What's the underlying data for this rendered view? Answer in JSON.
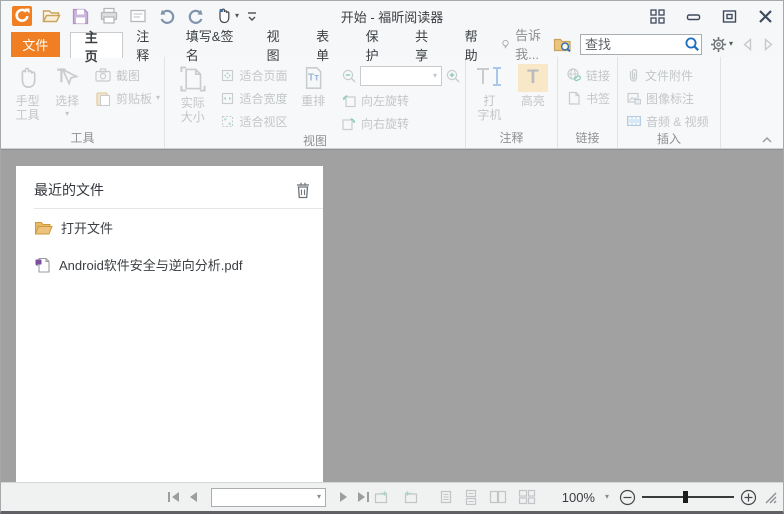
{
  "window": {
    "title": "开始 - 福昕阅读器"
  },
  "tabs": {
    "file": "文件",
    "items": [
      "主页",
      "注释",
      "填写&签名",
      "视图",
      "表单",
      "保护",
      "共享",
      "帮助"
    ],
    "active": "主页",
    "tell_me": "告诉我...",
    "search_placeholder": "查找"
  },
  "ribbon": {
    "tools": {
      "label": "工具",
      "hand": "手型\n工具",
      "select": "选择",
      "snapshot": "截图",
      "clipboard": "剪贴板"
    },
    "view": {
      "label": "视图",
      "actual_size": "实际\n大小",
      "fit_page": "适合页面",
      "fit_width": "适合宽度",
      "fit_visible": "适合视区",
      "reflow": "重排",
      "zoom_value": "",
      "rotate_left": "向左旋转",
      "rotate_right": "向右旋转"
    },
    "comment": {
      "label": "注释",
      "typewriter": "打\n字机",
      "highlight": "高亮"
    },
    "links": {
      "label": "链接",
      "link": "链接",
      "bookmark": "书签"
    },
    "insert": {
      "label": "插入",
      "attachment": "文件附件",
      "image_annotation": "图像标注",
      "audio_video": "音频 & 视频"
    }
  },
  "recent": {
    "title": "最近的文件",
    "open_file": "打开文件",
    "files": [
      "Android软件安全与逆向分析.pdf"
    ]
  },
  "status": {
    "page_value": "",
    "zoom_percent": "100%"
  },
  "icons": {
    "quick_access": [
      "foxit-logo",
      "open-folder-icon",
      "save-icon",
      "print-icon",
      "email-icon",
      "undo-icon",
      "redo-icon",
      "hand-tool-icon",
      "customize-toolbar-icon"
    ],
    "window_controls": [
      "fullscreen-icon",
      "minimize-icon",
      "restore-icon",
      "close-icon"
    ],
    "tab_row": [
      "lightbulb-icon",
      "folder-search-icon",
      "search-icon",
      "gear-icon",
      "back-icon",
      "forward-icon"
    ],
    "panel": [
      "trash-icon",
      "folder-icon",
      "pdf-file-icon"
    ],
    "status_bar": [
      "first-page-icon",
      "prev-page-icon",
      "next-page-icon",
      "last-page-icon",
      "prev-view-icon",
      "next-view-icon",
      "layout-single-icon",
      "layout-continuous-icon",
      "layout-facing-icon",
      "layout-continuous-facing-icon",
      "zoom-out-icon",
      "zoom-in-icon",
      "resize-grip-icon"
    ]
  },
  "colors": {
    "accent_orange": "#EF7F22",
    "highlight_swatch": "#F8E8C8",
    "folder_tan": "#E5AC52",
    "pdf_purple": "#7B4EA0",
    "search_blue": "#1A6EC0",
    "content_gray": "#A1A1A1"
  }
}
